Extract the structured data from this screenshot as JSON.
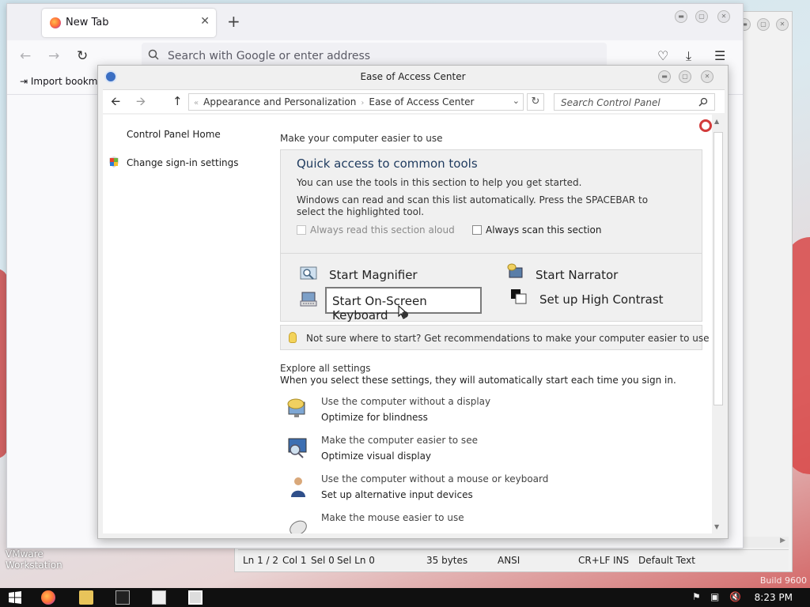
{
  "desktop": {
    "vmware_label_1": "VMware",
    "vmware_label_2": "Workstation",
    "build_label": "Build 9600"
  },
  "background_window": {
    "status": {
      "ln": "Ln 1 / 2",
      "col": "Col 1",
      "sel": "Sel 0",
      "sel_ln": "Sel Ln 0",
      "bytes": "35 bytes",
      "encoding": "ANSI",
      "eol": "CR+LF",
      "ins": "INS",
      "style": "Default Text"
    }
  },
  "firefox": {
    "tab_title": "New Tab",
    "url_placeholder": "Search with Google or enter address",
    "bookmark_label": "Import bookmarks..."
  },
  "control_panel": {
    "title": "Ease of Access Center",
    "breadcrumb": [
      "Appearance and Personalization",
      "Ease of Access Center"
    ],
    "search_placeholder": "Search Control Panel",
    "left_links": {
      "home": "Control Panel Home",
      "signin": "Change sign-in settings"
    },
    "intro": "Make your computer easier to use",
    "quick_access": {
      "title": "Quick access to common tools",
      "p1": "You can use the tools in this section to help you get started.",
      "p2": "Windows can read and scan this list automatically.  Press the SPACEBAR to select the highlighted tool.",
      "read_aloud": "Always read this section aloud",
      "scan": "Always scan this section",
      "tools": {
        "magnifier": "Start Magnifier",
        "narrator": "Start Narrator",
        "osk": "Start On-Screen Keyboard",
        "contrast": "Set up High Contrast"
      }
    },
    "tip": "Not sure where to start? Get recommendations to make your computer easier to use",
    "explore_title": "Explore all settings",
    "explore_desc": "When you select these settings, they will automatically start each time you sign in.",
    "settings": [
      {
        "title": "Use the computer without a display",
        "sub": "Optimize for blindness"
      },
      {
        "title": "Make the computer easier to see",
        "sub": "Optimize visual display"
      },
      {
        "title": "Use the computer without a mouse or keyboard",
        "sub": "Set up alternative input devices"
      },
      {
        "title": "Make the mouse easier to use",
        "sub": ""
      }
    ]
  },
  "taskbar": {
    "clock": "8:23 PM"
  }
}
